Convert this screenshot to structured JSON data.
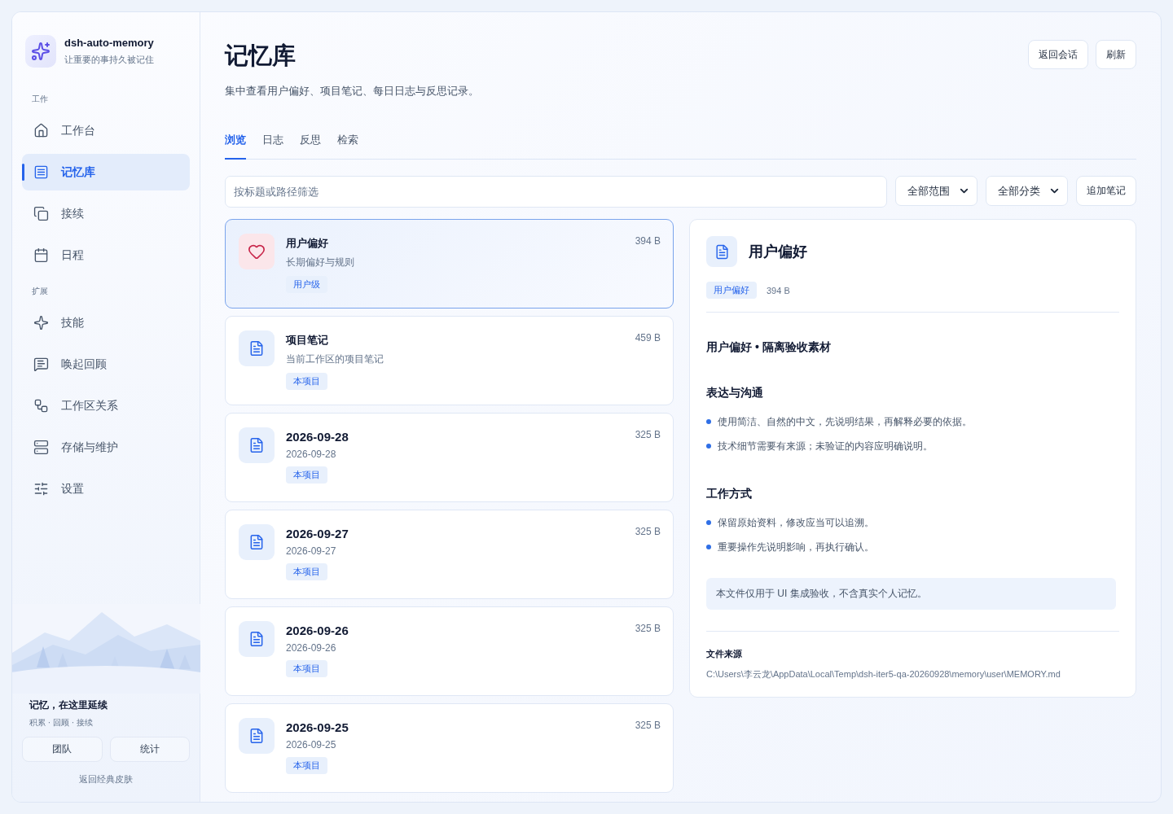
{
  "brand": {
    "name": "dsh-auto-memory",
    "tagline": "让重要的事持久被记住"
  },
  "sidebar": {
    "sections": [
      {
        "label": "工作",
        "items": [
          {
            "label": "工作台",
            "kind": "home",
            "selected": false
          },
          {
            "label": "记忆库",
            "kind": "note",
            "selected": true
          },
          {
            "label": "接续",
            "kind": "copy",
            "selected": false
          },
          {
            "label": "日程",
            "kind": "calendar",
            "selected": false
          }
        ]
      },
      {
        "label": "扩展",
        "items": [
          {
            "label": "技能",
            "kind": "sparkle",
            "selected": false
          },
          {
            "label": "唤起回顾",
            "kind": "message",
            "selected": false
          },
          {
            "label": "工作区关系",
            "kind": "workflow",
            "selected": false
          },
          {
            "label": "存储与维护",
            "kind": "server",
            "selected": false
          },
          {
            "label": "设置",
            "kind": "sliders",
            "selected": false
          }
        ]
      }
    ],
    "footer": {
      "title": "记忆，在这里延续",
      "subtitle": "积累 · 回顾 · 接续",
      "buttons": [
        "团队",
        "统计"
      ],
      "link": "返回经典皮肤"
    }
  },
  "header": {
    "title": "记忆库",
    "subtitle": "集中查看用户偏好、项目笔记、每日日志与反思记录。",
    "buttons": [
      "返回会话",
      "刷新"
    ]
  },
  "tabs": [
    {
      "label": "浏览",
      "selected": true
    },
    {
      "label": "日志",
      "selected": false
    },
    {
      "label": "反思",
      "selected": false
    },
    {
      "label": "检索",
      "selected": false
    }
  ],
  "filters": {
    "placeholder": "按标题或路径筛选",
    "selects": [
      "全部范围",
      "全部分类"
    ],
    "add_button": "追加笔记"
  },
  "notes": [
    {
      "kind": "heart",
      "title": "用户偏好",
      "subtitle": "长期偏好与规则",
      "tag": "用户级",
      "size": "394 B",
      "selected": true
    },
    {
      "kind": "doc",
      "title": "项目笔记",
      "subtitle": "当前工作区的项目笔记",
      "tag": "本项目",
      "size": "459 B",
      "selected": false
    },
    {
      "kind": "doc",
      "title": "2026-09-28",
      "subtitle": "2026-09-28",
      "tag": "本项目",
      "size": "325 B",
      "selected": false
    },
    {
      "kind": "doc",
      "title": "2026-09-27",
      "subtitle": "2026-09-27",
      "tag": "本项目",
      "size": "325 B",
      "selected": false
    },
    {
      "kind": "doc",
      "title": "2026-09-26",
      "subtitle": "2026-09-26",
      "tag": "本项目",
      "size": "325 B",
      "selected": false
    },
    {
      "kind": "doc",
      "title": "2026-09-25",
      "subtitle": "2026-09-25",
      "tag": "本项目",
      "size": "325 B",
      "selected": false
    }
  ],
  "detail": {
    "title": "用户偏好",
    "tag": "用户偏好",
    "size": "394 B",
    "heading": "用户偏好 • 隔离验收素材",
    "sections": [
      {
        "title": "表达与沟通",
        "items": [
          "使用简洁、自然的中文，先说明结果，再解释必要的依据。",
          "技术细节需要有来源；未验证的内容应明确说明。"
        ]
      },
      {
        "title": "工作方式",
        "items": [
          "保留原始资料，修改应当可以追溯。",
          "重要操作先说明影响，再执行确认。"
        ]
      }
    ],
    "note": "本文件仅用于 UI 集成验收，不含真实个人记忆。",
    "source_label": "文件来源",
    "source_path": "C:\\Users\\李云龙\\AppData\\Local\\Temp\\dsh-iter5-qa-20260928\\memory\\user\\MEMORY.md"
  }
}
